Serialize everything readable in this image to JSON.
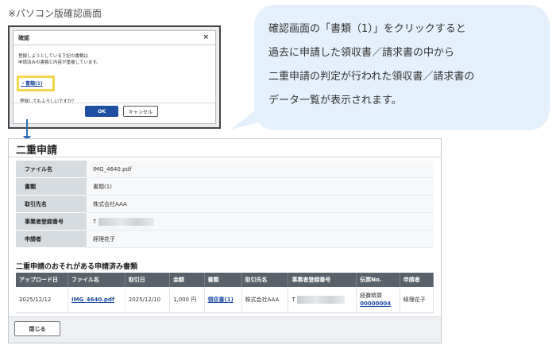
{
  "caption": "※パソコン版確認画面",
  "dialog": {
    "title": "確認",
    "close": "×",
    "message_line1": "登録しようとしている下記の書類は",
    "message_line2": "申請済みの書類と内容が重複しています。",
    "link": "・書類(1)",
    "question": "登録してもよろしいですか？",
    "ok": "OK",
    "cancel": "キャンセル"
  },
  "callout": {
    "line1": "確認画面の「書類（1）」をクリックすると",
    "line2": "過去に申請した領収書／請求書の中から",
    "line3": "二重申請の判定が行われた領収書／請求書の",
    "line4": "データ一覧が表示されます。"
  },
  "panel": {
    "title": "二重申請",
    "details": [
      {
        "label": "ファイル名",
        "value": "IMG_4640.pdf"
      },
      {
        "label": "書類",
        "value": "書類(1)"
      },
      {
        "label": "取引先名",
        "value": "株式会社AAA"
      },
      {
        "label": "事業者登録番号",
        "value": "T"
      },
      {
        "label": "申請者",
        "value": "経理花子"
      }
    ],
    "section_title": "二重申請のおそれがある申請済み書類",
    "columns": [
      "アップロード日",
      "ファイル名",
      "取引日",
      "金額",
      "書類",
      "取引先名",
      "事業者登録番号",
      "伝票No.",
      "申請者"
    ],
    "row": {
      "upload_date": "2025/12/12",
      "file_name": "IMG_4640.pdf",
      "deal_date": "2025/12/10",
      "amount": "1,000 円",
      "doc": "領収書(1)",
      "partner": "株式会社AAA",
      "reg_no": "T",
      "slip_type": "経費精算",
      "slip_no": "00000004",
      "applicant": "経理花子"
    },
    "close_button": "閉じる"
  }
}
